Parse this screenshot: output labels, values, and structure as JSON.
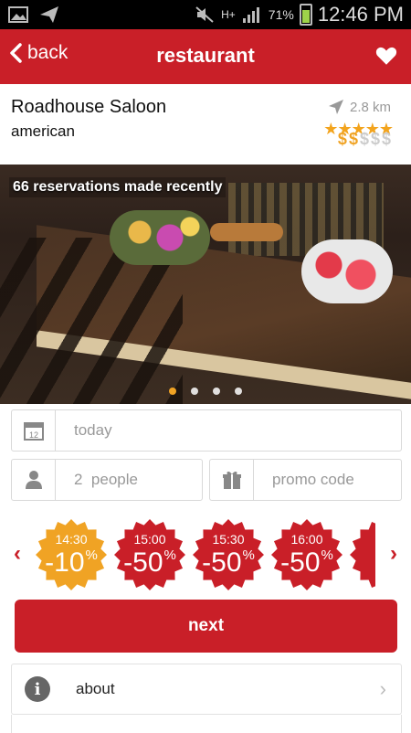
{
  "status_bar": {
    "battery": "71%",
    "network": "H+",
    "time": "12:46 PM"
  },
  "app_bar": {
    "back_label": "back",
    "title": "restaurant"
  },
  "restaurant": {
    "name": "Roadhouse Saloon",
    "cuisine": "american",
    "distance": "2.8 km",
    "rating_stars": 5,
    "price_level": 2,
    "price_max": 5
  },
  "photo": {
    "caption": "66 reservations made recently",
    "page_count": 4,
    "active_page": 0
  },
  "booking": {
    "date": "today",
    "people_count": "2",
    "people_label": "people",
    "promo_placeholder": "promo code"
  },
  "time_slots": [
    {
      "time": "14:30",
      "discount": "-10",
      "unit": "%",
      "color": "#f0a324"
    },
    {
      "time": "15:00",
      "discount": "-50",
      "unit": "%",
      "color": "#c91f28"
    },
    {
      "time": "15:30",
      "discount": "-50",
      "unit": "%",
      "color": "#c91f28"
    },
    {
      "time": "16:00",
      "discount": "-50",
      "unit": "%",
      "color": "#c91f28"
    }
  ],
  "actions": {
    "next_label": "next",
    "about_label": "about"
  },
  "colors": {
    "primary": "#c91f28",
    "accent": "#f0a324"
  }
}
